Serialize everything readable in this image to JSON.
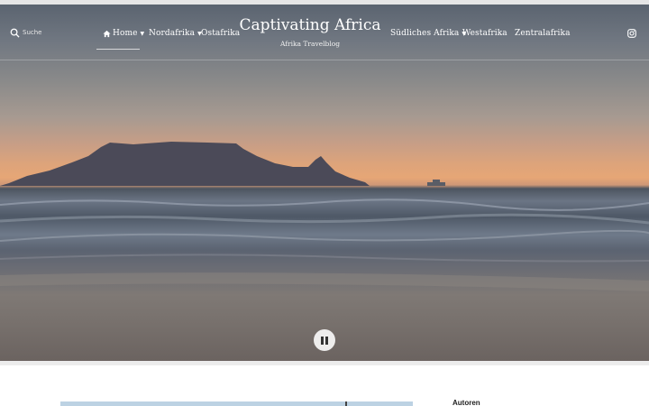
{
  "header": {
    "search": {
      "placeholder": "Suche",
      "icon": "search-icon"
    },
    "nav_left": [
      {
        "label": "Home",
        "icon": "home-icon",
        "has_submenu": true,
        "active": true
      },
      {
        "label": "Nordafrika",
        "has_submenu": true
      },
      {
        "label": "Ostafrika",
        "has_submenu": false
      }
    ],
    "site_title": "Captivating Africa",
    "site_tagline": "Afrika Travelblog",
    "nav_right": [
      {
        "label": "Südliches Afrika",
        "has_submenu": true
      },
      {
        "label": "Westafrika",
        "has_submenu": false
      },
      {
        "label": "Zentralafrika",
        "has_submenu": false
      }
    ],
    "social_icon": "instagram-icon"
  },
  "hero": {
    "media": "video of Table Mountain sunset seen from the beach",
    "control": "pause"
  },
  "sidebar": {
    "heading": "Autoren"
  },
  "colors": {
    "nav_text": "#ffffff",
    "accent": "#e6a676",
    "background": "#ffffff"
  }
}
